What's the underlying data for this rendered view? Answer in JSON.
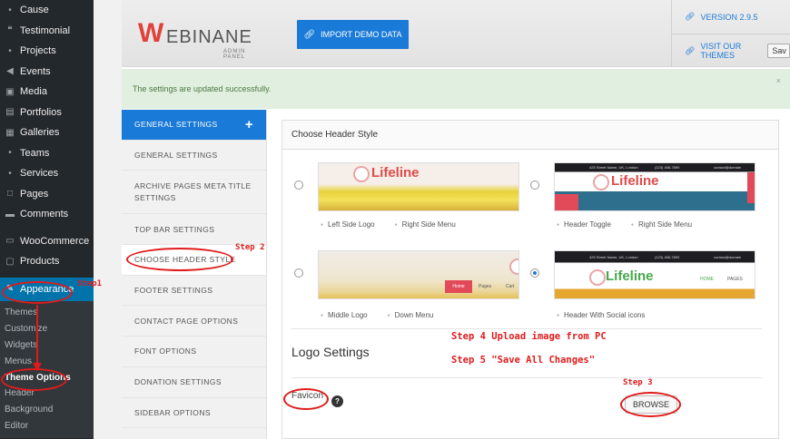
{
  "wp_menu": {
    "items": [
      {
        "label": "Cause",
        "icon": "pin-icon"
      },
      {
        "label": "Testimonial",
        "icon": "quote-icon"
      },
      {
        "label": "Projects",
        "icon": "pin-icon"
      },
      {
        "label": "Events",
        "icon": "megaphone-icon"
      },
      {
        "label": "Media",
        "icon": "media-icon"
      },
      {
        "label": "Portfolios",
        "icon": "portfolio-icon"
      },
      {
        "label": "Galleries",
        "icon": "gallery-icon"
      },
      {
        "label": "Teams",
        "icon": "pin-icon"
      },
      {
        "label": "Services",
        "icon": "pin-icon"
      },
      {
        "label": "Pages",
        "icon": "page-icon"
      },
      {
        "label": "Comments",
        "icon": "comment-icon"
      }
    ],
    "items2": [
      {
        "label": "WooCommerce",
        "icon": "woo-icon"
      },
      {
        "label": "Products",
        "icon": "cart-icon"
      }
    ],
    "appearance": "Appearance",
    "submenu": [
      "Themes",
      "Customize",
      "Widgets",
      "Menus",
      "Theme Options",
      "Header",
      "Background",
      "Editor"
    ]
  },
  "header": {
    "logo_letter": "W",
    "logo_name": "EBINANE",
    "logo_sub": "ADMIN PANEL",
    "import_label": "IMPORT DEMO DATA",
    "version": "VERSION 2.9.5",
    "visit": "VISIT OUR THEMES",
    "save_label": "Sav"
  },
  "notice": {
    "text": "The settings are updated successfully.",
    "close": "×"
  },
  "tabs": [
    "GENERAL SETTINGS",
    "GENERAL SETTINGS",
    "ARCHIVE PAGES META TITLE SETTINGS",
    "TOP BAR SETTINGS",
    "CHOOSE HEADER STYLE",
    "FOOTER SETTINGS",
    "CONTACT PAGE OPTIONS",
    "FONT OPTIONS",
    "DONATION SETTINGS",
    "SIDEBAR OPTIONS"
  ],
  "content": {
    "title": "Choose Header Style",
    "options": [
      {
        "brand": "Lifeline",
        "caps": [
          "Left Side Logo",
          "Right Side Menu"
        ]
      },
      {
        "brand": "Lifeline",
        "caps": [
          "Header Toggle",
          "Right Side Menu"
        ]
      },
      {
        "brand": "",
        "nav": [
          "Home",
          "Pages",
          "Cart"
        ],
        "caps": [
          "Middle Logo",
          "Down Menu"
        ]
      },
      {
        "brand": "Lifeline",
        "nav": [
          "HOME",
          "PAGES"
        ],
        "caps": [
          "Header With Social icons"
        ]
      }
    ],
    "topbar_text": "425 Street Name, UK, London",
    "topbar_phone": "(123) 456-7890",
    "topbar_mail": "contact@domain",
    "logo_settings": "Logo Settings",
    "favicon": "Favicon",
    "help": "?",
    "browse": "BROWSE"
  },
  "annotations": {
    "step1": "Step1",
    "step2": "Step 2",
    "step3": "Step 3",
    "step4": "Step 4   Upload image from PC",
    "step5": "Step 5   \"Save All Changes\""
  },
  "colors": {
    "accent": "#1a7ad8",
    "annotation": "#e01b1b",
    "wp_sidebar": "#23282d",
    "wp_active": "#0073aa"
  }
}
